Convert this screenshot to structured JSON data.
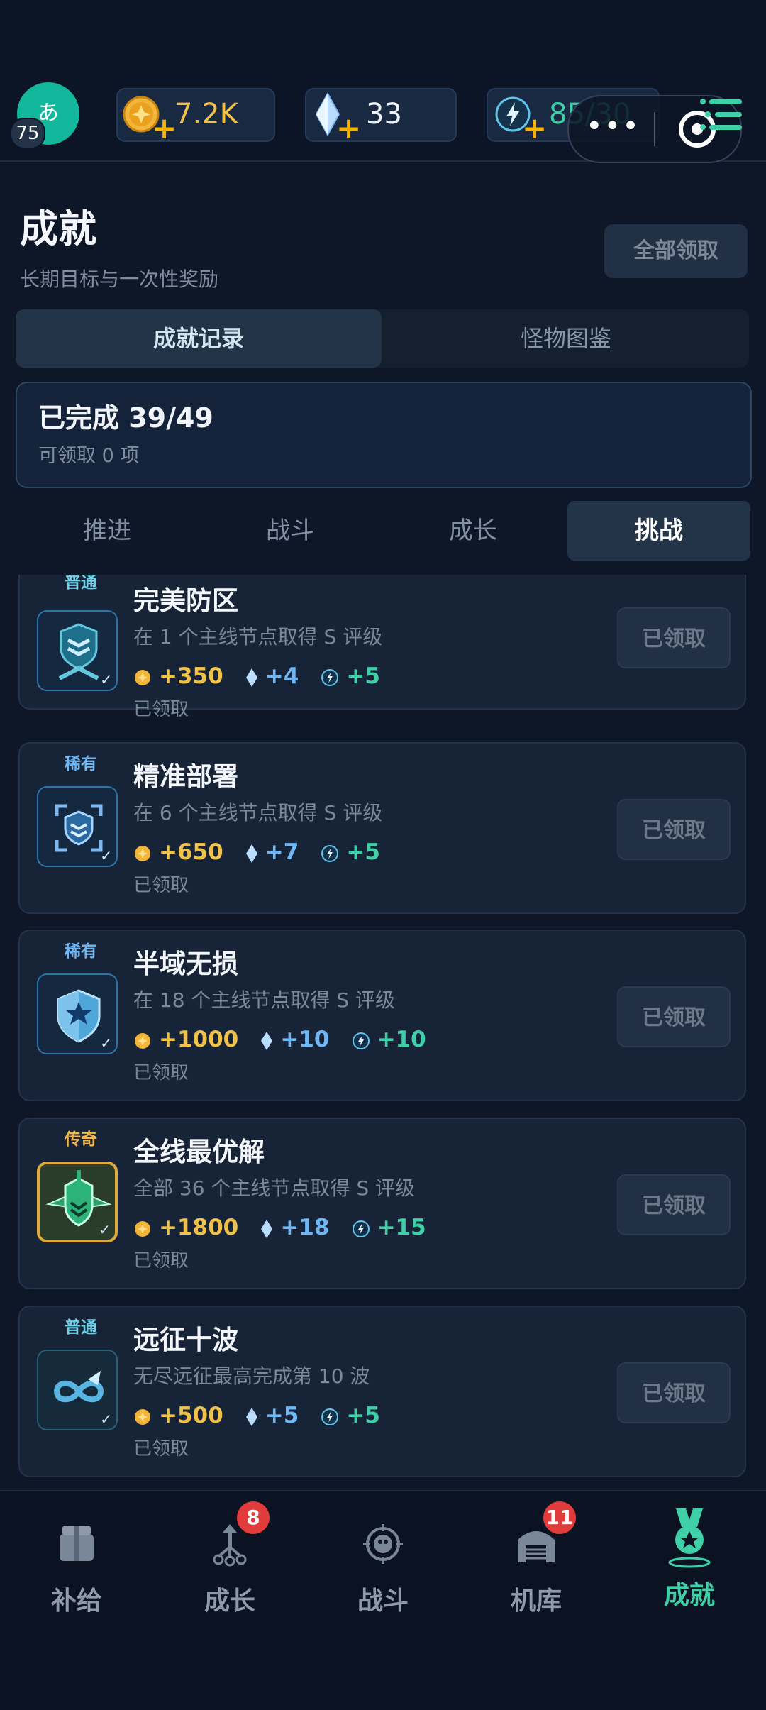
{
  "colors": {
    "accent": "#3fd0a8",
    "gold": "#f0c24a",
    "gem": "#6fb6f5",
    "badge": "#e23b3b",
    "common": "#6fd0e8",
    "rare": "#6fb6f5",
    "legendary": "#f2b84b"
  },
  "topbar": {
    "avatar_char": "あ",
    "level": "75",
    "gold": "7.2K",
    "gems": "33",
    "energy": "85/30"
  },
  "header": {
    "title": "成就",
    "subtitle": "长期目标与一次性奖励",
    "claim_all": "全部领取"
  },
  "segments": [
    "成就记录",
    "怪物图鉴"
  ],
  "progress": {
    "title": "已完成 39/49",
    "subtitle": "可领取 0 项"
  },
  "subtabs": [
    "推进",
    "战斗",
    "成长",
    "挑战"
  ],
  "achievements": [
    {
      "rarity": "普通",
      "title": "完美防区",
      "desc": "在 1 个主线节点取得 S 评级",
      "gold": "+350",
      "gems": "+4",
      "energy": "+5",
      "status": "已领取",
      "button": "已领取",
      "icon": "shield-chevron-icon"
    },
    {
      "rarity": "稀有",
      "title": "精准部署",
      "desc": "在 6 个主线节点取得 S 评级",
      "gold": "+650",
      "gems": "+7",
      "energy": "+5",
      "status": "已领取",
      "button": "已领取",
      "icon": "target-shield-icon"
    },
    {
      "rarity": "稀有",
      "title": "半域无损",
      "desc": "在 18 个主线节点取得 S 评级",
      "gold": "+1000",
      "gems": "+10",
      "energy": "+10",
      "status": "已领取",
      "button": "已领取",
      "icon": "star-shield-icon"
    },
    {
      "rarity": "传奇",
      "title": "全线最优解",
      "desc": "全部 36 个主线节点取得 S 评级",
      "gold": "+1800",
      "gems": "+18",
      "energy": "+15",
      "status": "已领取",
      "button": "已领取",
      "icon": "winged-shield-icon"
    },
    {
      "rarity": "普通",
      "title": "远征十波",
      "desc": "无尽远征最高完成第 10 波",
      "gold": "+500",
      "gems": "+5",
      "energy": "+5",
      "status": "已领取",
      "button": "已领取",
      "icon": "infinity-arrow-icon"
    }
  ],
  "nav": [
    {
      "label": "补给",
      "badge": "",
      "icon": "supply-crate-icon"
    },
    {
      "label": "成长",
      "badge": "8",
      "icon": "growth-tree-icon"
    },
    {
      "label": "战斗",
      "badge": "",
      "icon": "battle-target-icon"
    },
    {
      "label": "机库",
      "badge": "11",
      "icon": "hangar-icon"
    },
    {
      "label": "成就",
      "badge": "",
      "icon": "medal-icon"
    }
  ]
}
